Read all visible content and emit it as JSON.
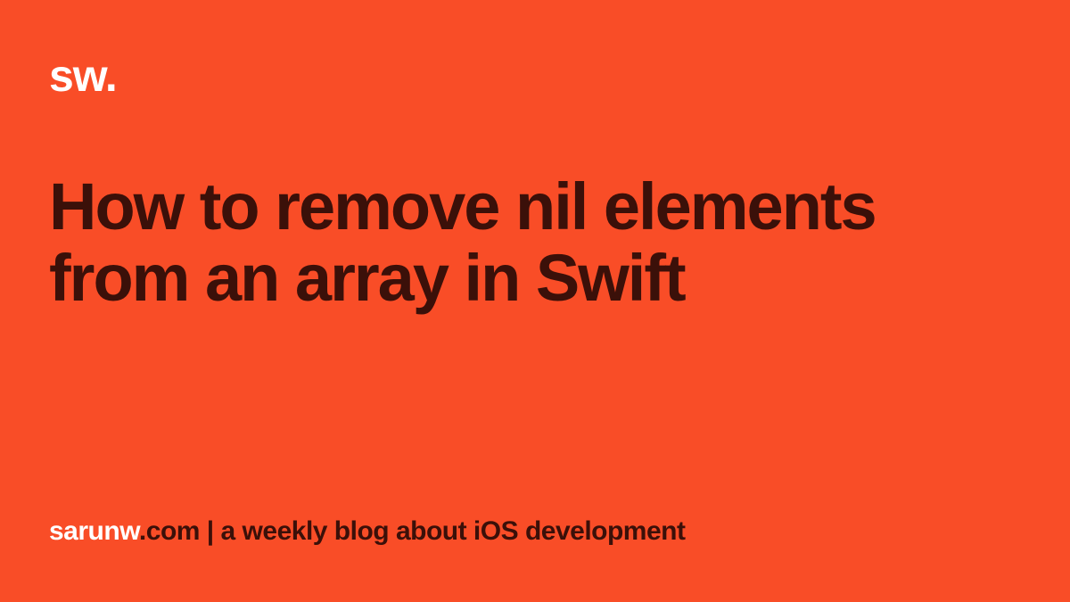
{
  "logo": "sw.",
  "title": "How to remove nil elements from an array in Swift",
  "footer": {
    "brand": "sarunw",
    "domain": ".com",
    "separator": " | ",
    "tagline": "a weekly blog about iOS development"
  },
  "colors": {
    "background": "#F94D27",
    "logo": "#FFFFFF",
    "title": "#3B1009",
    "footer_brand": "#FFFFFF",
    "footer_text": "#3B1009"
  }
}
